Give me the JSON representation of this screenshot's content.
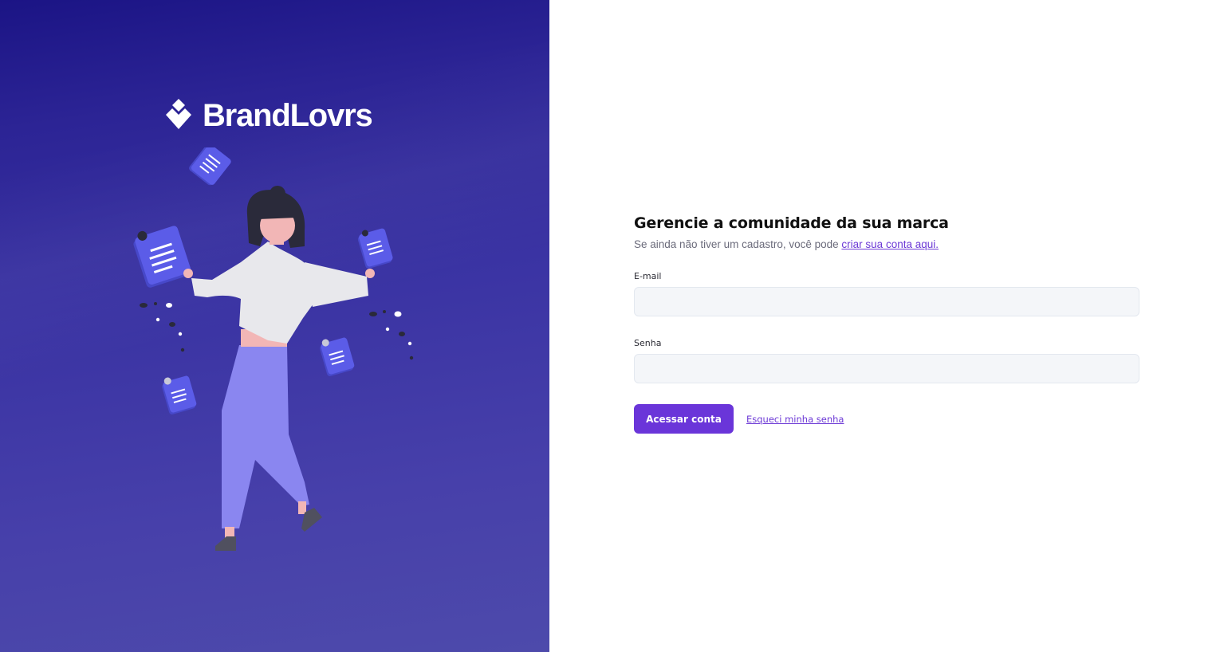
{
  "brand": {
    "name": "BrandLovrs",
    "logo_icon": "diamond-logo-icon"
  },
  "illustration": {
    "icon": "person-juggling-documents-illustration"
  },
  "login": {
    "heading": "Gerencie a comunidade da sua marca",
    "subtext_prefix": "Se ainda não tiver um cadastro, você pode ",
    "signup_link_label": "criar sua conta aqui.",
    "email_label": "E-mail",
    "email_value": "",
    "password_label": "Senha",
    "password_value": "",
    "submit_label": "Acessar conta",
    "forgot_label": "Esqueci minha senha"
  },
  "colors": {
    "panel_top": "#1b1485",
    "panel_bottom": "#4d4aab",
    "accent": "#6a35d9",
    "document": "#5b5ce8",
    "pants": "#8a86f0",
    "input_bg": "#f4f6f9"
  }
}
